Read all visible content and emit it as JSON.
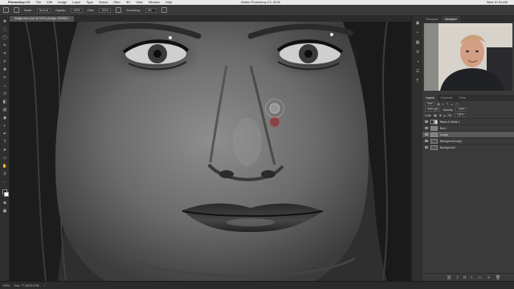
{
  "menubar": {
    "app": "Photoshop CC",
    "items": [
      "File",
      "Edit",
      "Image",
      "Layer",
      "Type",
      "Select",
      "Filter",
      "3D",
      "View",
      "Window",
      "Help"
    ],
    "window_title": "Adobe Photoshop CC 2018",
    "clock": "Wed 10:34 AM"
  },
  "options_bar": {
    "mode_label": "Mode:",
    "mode_value": "Normal",
    "opacity_label": "Opacity:",
    "opacity_value": "100%",
    "flow_label": "Flow:",
    "flow_value": "100%",
    "smoothing_label": "Smoothing:",
    "smoothing_value": "0%"
  },
  "document_tab": "Dodge-burn.psd @ 100% (Dodge, RGB/8) *",
  "status_bar": {
    "zoom": "100%",
    "doc_info": "Doc: 77.1M/218.9M"
  },
  "right_panel": {
    "top_tabs": [
      "Histogram",
      "Navigator"
    ],
    "layers_tabs": [
      "Layers",
      "Channels",
      "Paths"
    ],
    "kind_label": "Kind",
    "blend_mode": "Soft Light",
    "opacity_label": "Opacity:",
    "opacity_value": "100%",
    "lock_label": "Lock:",
    "fill_label": "Fill:",
    "fill_value": "100%",
    "layers": [
      {
        "name": "Black & White 1",
        "selected": false
      },
      {
        "name": "Burn",
        "selected": false
      },
      {
        "name": "Dodge",
        "selected": true
      },
      {
        "name": "Background copy",
        "selected": false
      },
      {
        "name": "Background",
        "selected": false
      }
    ]
  },
  "colors": {
    "accent": "#3a3a3a",
    "dodge_cursor": "#9a9a9a",
    "burn_cursor": "#8a3a3a"
  }
}
